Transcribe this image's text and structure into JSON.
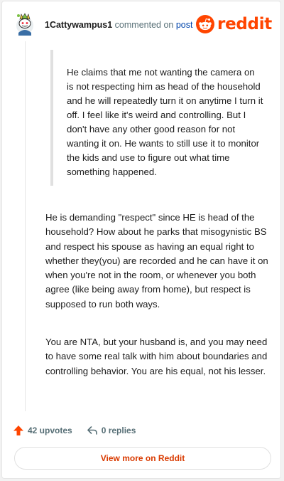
{
  "header": {
    "username": "1Cattywampus1",
    "commented_on": "commented on",
    "post_link": "post",
    "logo_text": "reddit",
    "logo_icon": "reddit-snoo-icon",
    "avatar_icon": "snoo-avatar-icon"
  },
  "comment": {
    "quote": "He claims that me not wanting the camera on is not respecting him as head of the household and he will repeatedly turn it on anytime I turn it off. I feel like it's weird and controlling. But I don't have any other good reason for not wanting it on. He wants to still use it to monitor the kids and use to figure out what time something happened.",
    "paragraphs": [
      "He is demanding \"respect\" since HE is head of the household? How about he parks that misogynistic BS and respect his spouse as having an equal right to whether they(you) are recorded and he can have it on when you're not in the room, or whenever you both agree (like being away from home), but respect is supposed to run both ways.",
      "You are NTA, but your husband is, and you may need to have some real talk with him about boundaries and controlling behavior. You are his equal, not his lesser."
    ]
  },
  "actions": {
    "upvotes": "42 upvotes",
    "replies": "0 replies",
    "view_more": "View more on Reddit"
  },
  "colors": {
    "brand": "#ff4500",
    "link": "#0045ac",
    "view_more_text": "#d93a00"
  }
}
